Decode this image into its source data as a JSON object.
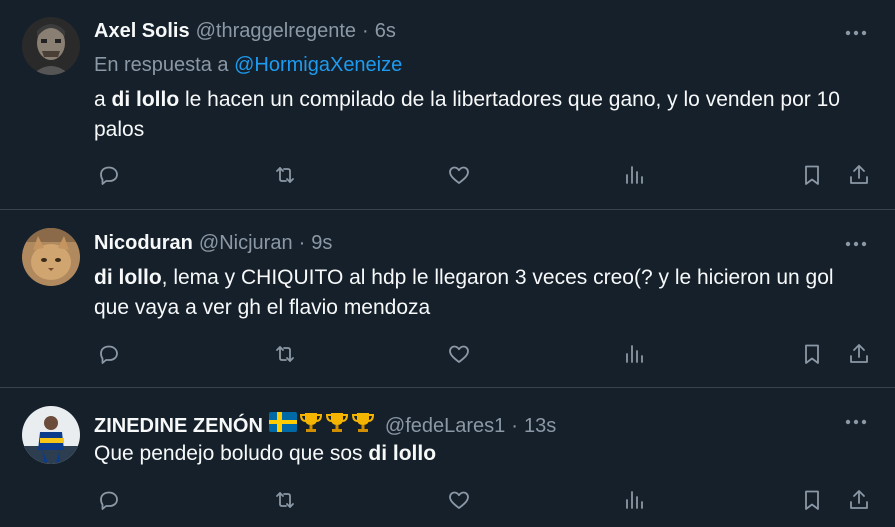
{
  "tweets": [
    {
      "name": "Axel Solis",
      "handle": "@thraggelregente",
      "sep": "·",
      "time": "6s",
      "reply_prefix": "En respuesta a",
      "reply_mention": "@HormigaXeneize",
      "text_parts": [
        {
          "t": "a ",
          "b": false
        },
        {
          "t": "di lollo",
          "b": true
        },
        {
          "t": " le hacen un compilado de la libertadores que gano, y lo venden por 10 palos",
          "b": false
        }
      ],
      "avatar_icon": "avatar-image"
    },
    {
      "name": "Nicoduran",
      "handle": "@Nicjuran",
      "sep": "·",
      "time": "9s",
      "text_parts": [
        {
          "t": "di lollo",
          "b": true
        },
        {
          "t": ", lema y CHIQUITO al hdp le llegaron 3 veces creo(? y le hicieron un gol que vaya a ver gh el flavio mendoza",
          "b": false
        }
      ],
      "avatar_icon": "avatar-image"
    },
    {
      "name": "ZINEDINE ZENÓN",
      "name_emojis": [
        "sweden-flag-icon",
        "trophy-icon",
        "trophy-icon",
        "trophy-icon"
      ],
      "handle": "@fedeLares1",
      "sep": "·",
      "time": "13s",
      "text_parts": [
        {
          "t": "Que pendejo boludo que sos ",
          "b": false
        },
        {
          "t": "di lollo",
          "b": true
        }
      ],
      "avatar_icon": "avatar-image"
    }
  ],
  "action_icons": [
    "reply-icon",
    "retweet-icon",
    "like-icon",
    "views-icon",
    "bookmark-icon",
    "share-icon"
  ],
  "colors": {
    "background": "#15202b",
    "text": "#f7f9f9",
    "secondary": "#8b98a5",
    "link": "#1d9bf0",
    "divider": "#38444d"
  }
}
